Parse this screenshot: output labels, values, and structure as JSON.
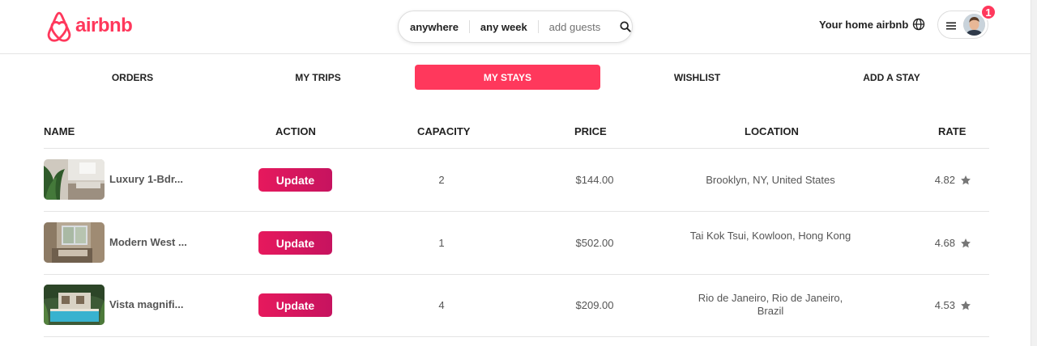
{
  "brand": {
    "name": "airbnb",
    "color": "#ff385c"
  },
  "search": {
    "location": "anywhere",
    "dates": "any week",
    "guests_placeholder": "add guests",
    "icon": "search-icon"
  },
  "header": {
    "host_link": "Your home airbnb",
    "globe_icon": "globe-icon",
    "menu_icon": "hamburger-icon",
    "notification_count": "1"
  },
  "tabs": [
    {
      "label": "ORDERS",
      "active": false
    },
    {
      "label": "MY TRIPS",
      "active": false
    },
    {
      "label": "MY STAYS",
      "active": true
    },
    {
      "label": "WISHLIST",
      "active": false
    },
    {
      "label": "ADD A STAY",
      "active": false
    }
  ],
  "table": {
    "columns": [
      "NAME",
      "ACTION",
      "CAPACITY",
      "PRICE",
      "LOCATION",
      "RATE"
    ],
    "rows": [
      {
        "name": "Luxury 1-Bdr...",
        "action": "Update",
        "capacity": "2",
        "price": "$144.00",
        "location": "Brooklyn, NY, United States",
        "rate": "4.82"
      },
      {
        "name": "Modern West ...",
        "action": "Update",
        "capacity": "1",
        "price": "$502.00",
        "location": "Tai Kok Tsui, Kowloon, Hong Kong",
        "rate": "4.68"
      },
      {
        "name": "Vista magnifi...",
        "action": "Update",
        "capacity": "4",
        "price": "$209.00",
        "location": "Rio de Janeiro, Rio de Janeiro, Brazil",
        "rate": "4.53"
      }
    ]
  },
  "colors": {
    "accent": "#ff385c",
    "button_gradient_start": "#e6195d",
    "button_gradient_end": "#c6135f",
    "star": "#777777"
  }
}
